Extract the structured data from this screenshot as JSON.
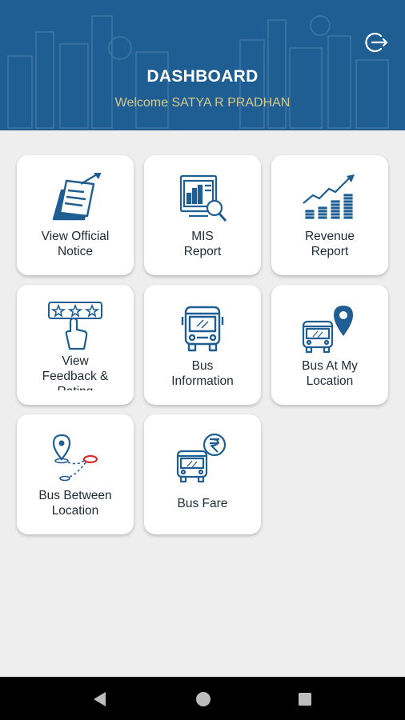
{
  "header": {
    "title": "DASHBOARD",
    "welcome": "Welcome SATYA R PRADHAN",
    "logout_icon": "logout-icon"
  },
  "colors": {
    "header_bg": "#1f5e92",
    "icon_blue": "#1f5e92",
    "accent_red": "#d62b2b",
    "welcome_text": "#d6c98a"
  },
  "tiles": [
    {
      "label_line1": "View Official",
      "label_line2": "Notice",
      "icon": "notice-icon"
    },
    {
      "label_line1": "MIS",
      "label_line2": "Report",
      "icon": "report-icon"
    },
    {
      "label_line1": "Revenue",
      "label_line2": "Report",
      "icon": "revenue-icon"
    },
    {
      "label_line1": "View",
      "label_line2": "Feedback &",
      "label_line3": "Rating",
      "icon": "feedback-icon"
    },
    {
      "label_line1": "Bus",
      "label_line2": "Information",
      "icon": "bus-icon"
    },
    {
      "label_line1": "Bus At My",
      "label_line2": "Location",
      "icon": "bus-location-icon"
    },
    {
      "label_line1": "Bus Between",
      "label_line2": "Location",
      "icon": "route-icon"
    },
    {
      "label_line1": "Bus Fare",
      "icon": "rupee-bus-icon"
    }
  ],
  "navbar": {
    "back": "back-icon",
    "home": "home-icon",
    "recents": "recents-icon"
  }
}
